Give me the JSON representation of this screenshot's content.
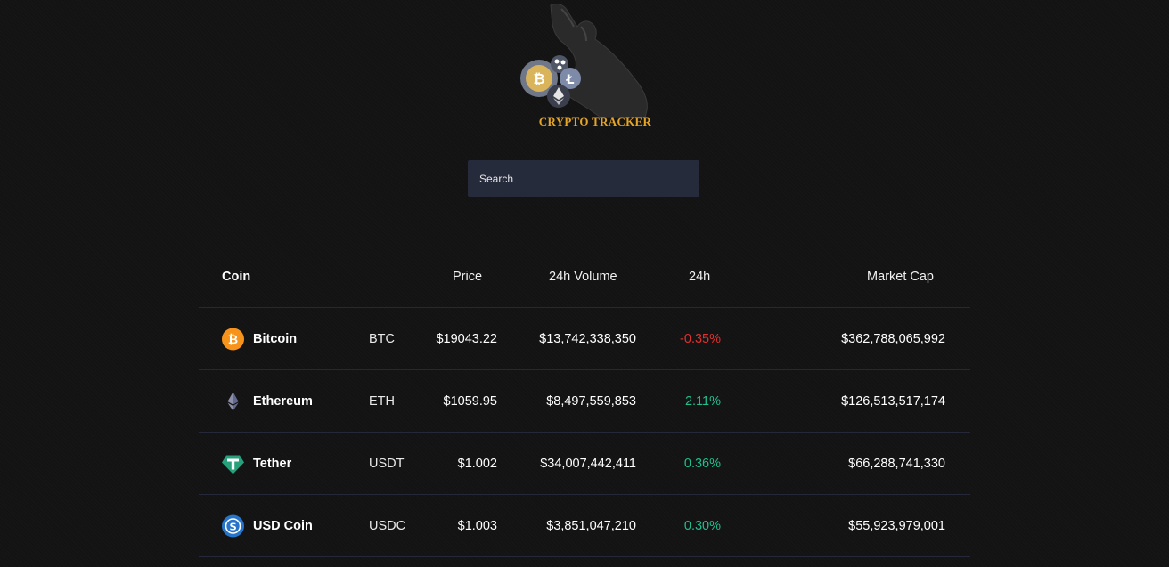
{
  "brand": {
    "logo_text": "CRYPTO TRACKER",
    "accent_color": "#e6a526"
  },
  "search": {
    "placeholder": "Search",
    "value": ""
  },
  "table": {
    "headers": {
      "coin": "Coin",
      "price": "Price",
      "volume": "24h Volume",
      "change": "24h",
      "market_cap": "Market Cap"
    },
    "rows": [
      {
        "icon": "bitcoin-icon",
        "name": "Bitcoin",
        "symbol": "BTC",
        "price": "$19043.22",
        "volume": "$13,742,338,350",
        "change": "-0.35%",
        "change_direction": "negative",
        "market_cap": "$362,788,065,992"
      },
      {
        "icon": "ethereum-icon",
        "name": "Ethereum",
        "symbol": "ETH",
        "price": "$1059.95",
        "volume": "$8,497,559,853",
        "change": "2.11%",
        "change_direction": "positive",
        "market_cap": "$126,513,517,174"
      },
      {
        "icon": "tether-icon",
        "name": "Tether",
        "symbol": "USDT",
        "price": "$1.002",
        "volume": "$34,007,442,411",
        "change": "0.36%",
        "change_direction": "positive",
        "market_cap": "$66,288,741,330"
      },
      {
        "icon": "usd-coin-icon",
        "name": "USD Coin",
        "symbol": "USDC",
        "price": "$1.003",
        "volume": "$3,851,047,210",
        "change": "0.30%",
        "change_direction": "positive",
        "market_cap": "$55,923,979,001"
      }
    ],
    "colors": {
      "negative": "#e03131",
      "positive": "#1fbf8f"
    }
  }
}
